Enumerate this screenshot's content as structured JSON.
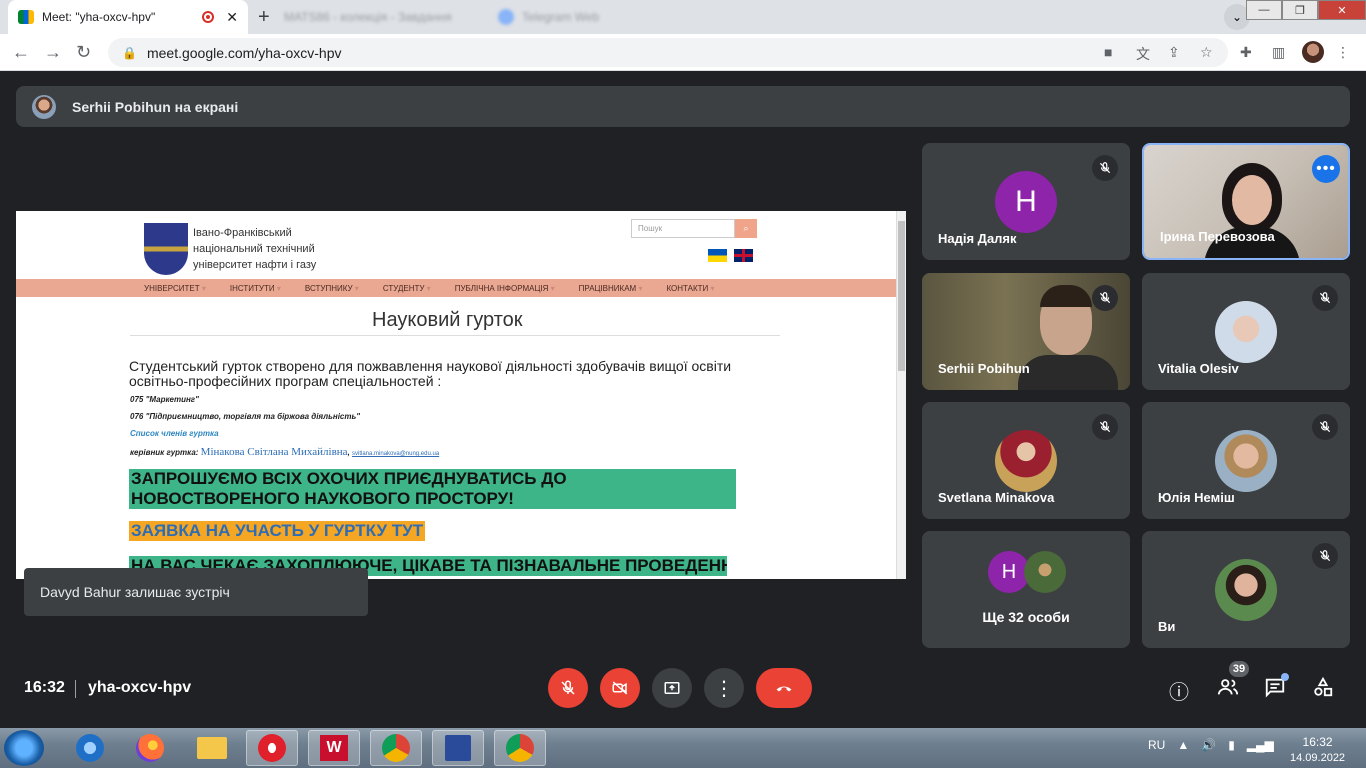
{
  "browser": {
    "active_tab_title": "Meet: \"yha-oxcv-hpv\"",
    "tab2_title": "MATS86 - колекція - Завдання",
    "tab3_title": "Telegram Web",
    "url": "meet.google.com/yha-oxcv-hpv"
  },
  "meet": {
    "presenter_banner": "Serhii Pobihun на екрані",
    "toast": "Davyd Bahur залишає зустріч",
    "time": "16:32",
    "meeting_code": "yha-oxcv-hpv",
    "participants_badge": "39",
    "tiles": [
      {
        "name": "Надія Даляк",
        "letter": "H"
      },
      {
        "name": "Ірина Перевозова"
      },
      {
        "name": "Serhii Pobihun"
      },
      {
        "name": "Vitalia Olesiv"
      },
      {
        "name": "Svetlana Minakova"
      },
      {
        "name": "Юлія Неміш"
      },
      {
        "name": "Ще 32 особи",
        "letter": "H"
      },
      {
        "name": "Ви"
      }
    ]
  },
  "shared_site": {
    "uni_name": "Івано-Франківський національний технічний університет нафти і газу",
    "search_placeholder": "Пошук",
    "nav": [
      "УНІВЕРСИТЕТ",
      "ІНСТИТУТИ",
      "ВСТУПНИКУ",
      "СТУДЕНТУ",
      "ПУБЛІЧНА ІНФОРМАЦІЯ",
      "ПРАЦІВНИКАМ",
      "КОНТАКТИ"
    ],
    "title": "Науковий гурток",
    "intro": "Студентський гурток створено для пожвавлення наукової діяльності здобувачів вищої освіти освітньо-професійних програм спеціальностей :",
    "spec1": "075 \"Маркетинг\"",
    "spec2": "076 \"Підприємництво, торгівля та біржова діяльність\"",
    "members_link": "Список членів гуртка",
    "leader_label": "керівник гуртка:",
    "leader_name": "Мінакова Світлана Михайлівна",
    "leader_email": "svitlana.minakova@nung.edu.ua",
    "invite": "ЗАПРОШУЄМО ВСІХ ОХОЧИХ ПРИЄДНУВАТИСЬ ДО НОВОСТВОРЕНОГО НАУКОВОГО ПРОСТОРУ!",
    "apply": "ЗАЯВКА НА УЧАСТЬ У ГУРТКУ ТУТ",
    "wait": "НА ВАС ЧЕКАЄ ЗАХОПЛЮЮЧЕ, ЦІКАВЕ ТА ПІЗНАВАЛЬНЕ ПРОВЕДЕННЯ"
  },
  "taskbar": {
    "lang": "RU",
    "time": "16:32",
    "date": "14.09.2022"
  },
  "colors": {
    "meet_bg": "#202124",
    "tile_bg": "#3c4043",
    "red": "#ea4335",
    "highlight_green": "#3eb489",
    "highlight_orange": "#f5a623",
    "site_nav": "#eaa893"
  }
}
